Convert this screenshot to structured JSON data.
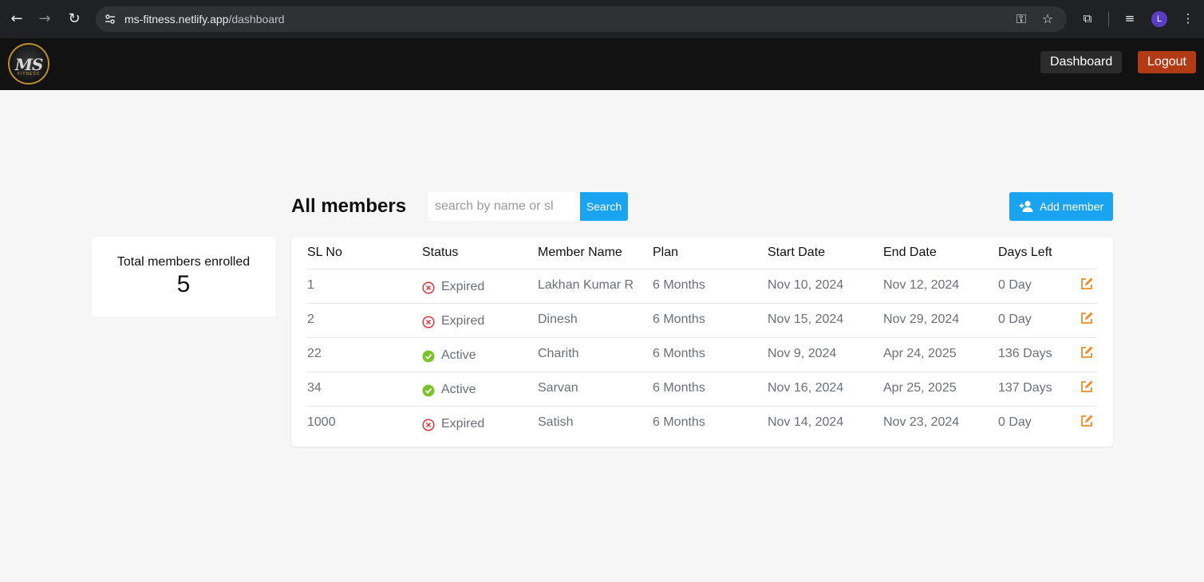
{
  "browser": {
    "url_host": "ms-fitness.netlify.app",
    "url_path": "/dashboard",
    "profile_initial": "L"
  },
  "header": {
    "logo_text": "MS",
    "logo_subtext": "FITNESS",
    "dashboard_label": "Dashboard",
    "logout_label": "Logout"
  },
  "stats": {
    "label": "Total members enrolled",
    "value": "5"
  },
  "main": {
    "title": "All members",
    "search_placeholder": "search by name or sl",
    "search_label": "Search",
    "add_member_label": "Add member"
  },
  "table": {
    "columns": [
      "SL No",
      "Status",
      "Member Name",
      "Plan",
      "Start Date",
      "End Date",
      "Days Left"
    ],
    "rows": [
      {
        "sl": "1",
        "status": "Expired",
        "name": "Lakhan Kumar R",
        "plan": "6 Months",
        "start": "Nov 10, 2024",
        "end": "Nov 12, 2024",
        "days": "0 Day"
      },
      {
        "sl": "2",
        "status": "Expired",
        "name": "Dinesh",
        "plan": "6 Months",
        "start": "Nov 15, 2024",
        "end": "Nov 29, 2024",
        "days": "0 Day"
      },
      {
        "sl": "22",
        "status": "Active",
        "name": "Charith",
        "plan": "6 Months",
        "start": "Nov 9, 2024",
        "end": "Apr 24, 2025",
        "days": "136 Days"
      },
      {
        "sl": "34",
        "status": "Active",
        "name": "Sarvan",
        "plan": "6 Months",
        "start": "Nov 16, 2024",
        "end": "Apr 25, 2025",
        "days": "137 Days"
      },
      {
        "sl": "1000",
        "status": "Expired",
        "name": "Satish",
        "plan": "6 Months",
        "start": "Nov 14, 2024",
        "end": "Nov 23, 2024",
        "days": "0 Day"
      }
    ]
  },
  "colors": {
    "accent": "#1aa3f0",
    "logout": "#b23a14",
    "active": "#7cc22b",
    "expired": "#d9363e",
    "edit": "#f08a24"
  }
}
